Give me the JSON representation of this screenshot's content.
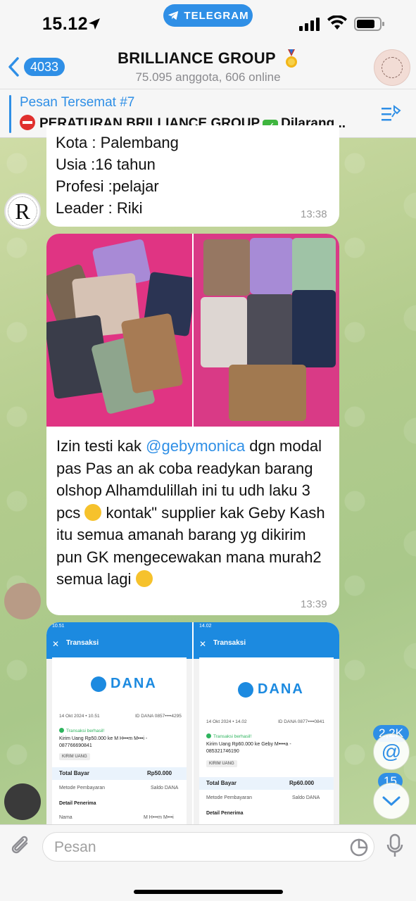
{
  "status_bar": {
    "time": "15.12",
    "app_pill": "TELEGRAM"
  },
  "header": {
    "back_count": "4033",
    "title": "BRILLIANCE GROUP",
    "subtitle": "75.095 anggota, 606 online"
  },
  "pinned": {
    "title": "Pesan Tersemat #7",
    "text_before": "PERATURAN BRILLIANCE GROUP",
    "text_after": "Dilarang..."
  },
  "messages": [
    {
      "lines": [
        "Kota : Palembang",
        "Usia :16 tahun",
        "Profesi :pelajar",
        "Leader : Riki"
      ],
      "time": "13:38",
      "avatar_letter": "R"
    },
    {
      "caption_pre": "Izin testi kak ",
      "mention": "@gebymonica",
      "caption_mid": " dgn modal pas Pas an ak coba readykan barang olshop Alhamdulillah ini tu udh laku 3 pcs ",
      "caption_mid2": " kontak\" supplier kak Geby Kash itu semua amanah barang yg dikirim pun GK mengecewakan mana murah2 semua lagi ",
      "time": "13:39"
    }
  ],
  "receipts": [
    {
      "status_time": "10.51",
      "header": "Transaksi",
      "logo": "DANA",
      "date": "14 Okt 2024 • 10.51",
      "id": "ID DANA 0857••••4295",
      "status": "Transaksi berhasil!",
      "detail": "Kirim Uang Rp50.000 ke M H•••m M•••i -",
      "detail2": "087766690841",
      "tag": "KIRIM UANG",
      "total_label": "Total Bayar",
      "total_value": "Rp50.000",
      "method_label": "Metode Pembayaran",
      "method_value": "Saldo DANA",
      "recipient_label": "Detail Penerima",
      "name_label": "Nama",
      "name_value": "M H•••m M•••i"
    },
    {
      "status_time": "14.02",
      "header": "Transaksi",
      "logo": "DANA",
      "date": "14 Okt 2024 • 14.02",
      "id": "ID DANA 0877••••0841",
      "status": "Transaksi berhasil!",
      "detail": "Kirim Uang Rp60.000 ke Geby M••••a -",
      "detail2": "085321746190",
      "tag": "KIRIM UANG",
      "total_label": "Total Bayar",
      "total_value": "Rp60.000",
      "method_label": "Metode Pembayaran",
      "method_value": "Saldo DANA",
      "recipient_label": "Detail Penerima"
    }
  ],
  "floating": {
    "mentions_count": "2,2K",
    "unread_count": "15"
  },
  "input": {
    "placeholder": "Pesan"
  },
  "colors": {
    "accent": "#2f8fe6",
    "bubble": "#ffffff",
    "wallpaper": "#b3cc8d"
  }
}
